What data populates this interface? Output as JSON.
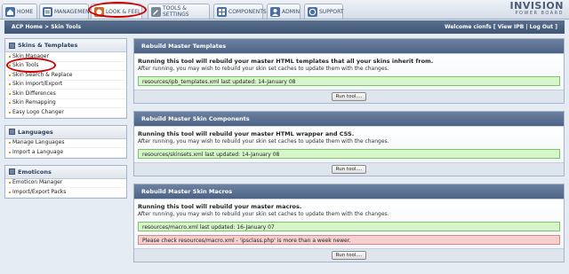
{
  "tabs": [
    {
      "label": "HOME",
      "icon": "home-icon"
    },
    {
      "label": "MANAGEMENT",
      "icon": "management-icon"
    },
    {
      "label": "LOOK & FEEL",
      "icon": "look-feel-icon"
    },
    {
      "label": "TOOLS & SETTINGS",
      "icon": "tools-icon"
    },
    {
      "label": "COMPONENTS",
      "icon": "components-icon"
    },
    {
      "label": "ADMIN",
      "icon": "admin-icon"
    },
    {
      "label": "SUPPORT",
      "icon": "support-icon"
    }
  ],
  "logo": {
    "line1": "INVISION",
    "line2": "POWER BOARD"
  },
  "nav": {
    "breadcrumb": "ACP Home > Skin Tools",
    "welcome": "Welcome cionfs",
    "view_ipb": "View IPB",
    "logout": "Log Out",
    "sep": "|",
    "open_bracket": "[",
    "close_bracket": "]"
  },
  "sidebar": {
    "skins": {
      "title": "Skins & Templates",
      "items": [
        "Skin Manager",
        "Skin Tools",
        "Skin Search & Replace",
        "Skin Import/Export",
        "Skin Differences",
        "Skin Remapping",
        "Easy Logo Changer"
      ]
    },
    "languages": {
      "title": "Languages",
      "items": [
        "Manage Languages",
        "Import a Language"
      ]
    },
    "emoticons": {
      "title": "Emoticons",
      "items": [
        "Emoticon Manager",
        "Import/Export Packs"
      ]
    }
  },
  "panels": [
    {
      "title": "Rebuild Master Templates",
      "heading": "Running this tool will rebuild your master HTML templates that all your skins inherit from.",
      "sub": "After running, you may wish to rebuild your skin set caches to update them with the changes.",
      "ok": "resources/ipb_templates.xml last updated: 14-January 08",
      "button": "Run tool...."
    },
    {
      "title": "Rebuild Master Skin Components",
      "heading": "Running this tool will rebuild your master HTML wrapper and CSS.",
      "sub": "After running, you may wish to rebuild your skin set caches to update them with the changes.",
      "ok": "resources/skinsets.xml last updated: 14-January 08",
      "button": "Run tool...."
    },
    {
      "title": "Rebuild Master Skin Macros",
      "heading": "Running this tool will rebuild your master macros.",
      "sub": "After running, you may wish to rebuild your skin set caches to update them with the changes.",
      "ok": "resources/macro.xml last updated: 16-January 07",
      "error": "Please check resources/macro.xml - 'ipsclass.php' is more than a week newer.",
      "button": "Run tool...."
    }
  ],
  "colors": {
    "annotation": "#d10000",
    "accent": "#4d6385",
    "ok": "#d6f5c8",
    "error": "#f6cfcf"
  }
}
